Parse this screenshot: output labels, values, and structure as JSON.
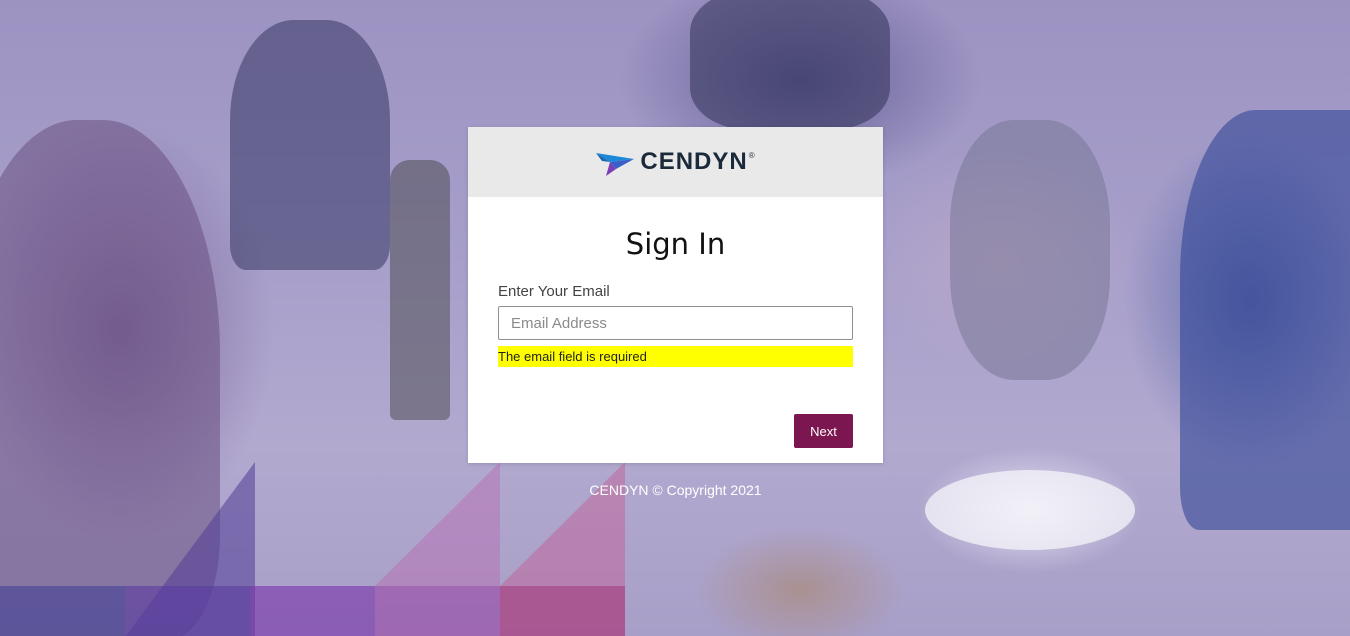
{
  "brand": {
    "name": "CENDYN",
    "registered_mark": "®",
    "logo_icon": "cendyn-arrow-icon",
    "colors": {
      "logo_blue": "#1e88d8",
      "logo_purple": "#7a3fb6",
      "logo_text": "#1b2a3a"
    }
  },
  "signin": {
    "title": "Sign In",
    "email_label": "Enter Your Email",
    "email_value": "",
    "email_placeholder": "Email Address",
    "error_message": "The email field is required",
    "next_label": "Next"
  },
  "footer": {
    "copyright": "CENDYN © Copyright 2021"
  },
  "colors": {
    "primary_button": "#7b1650",
    "error_highlight": "#ffff00",
    "header_bg": "#e9e9e9"
  }
}
